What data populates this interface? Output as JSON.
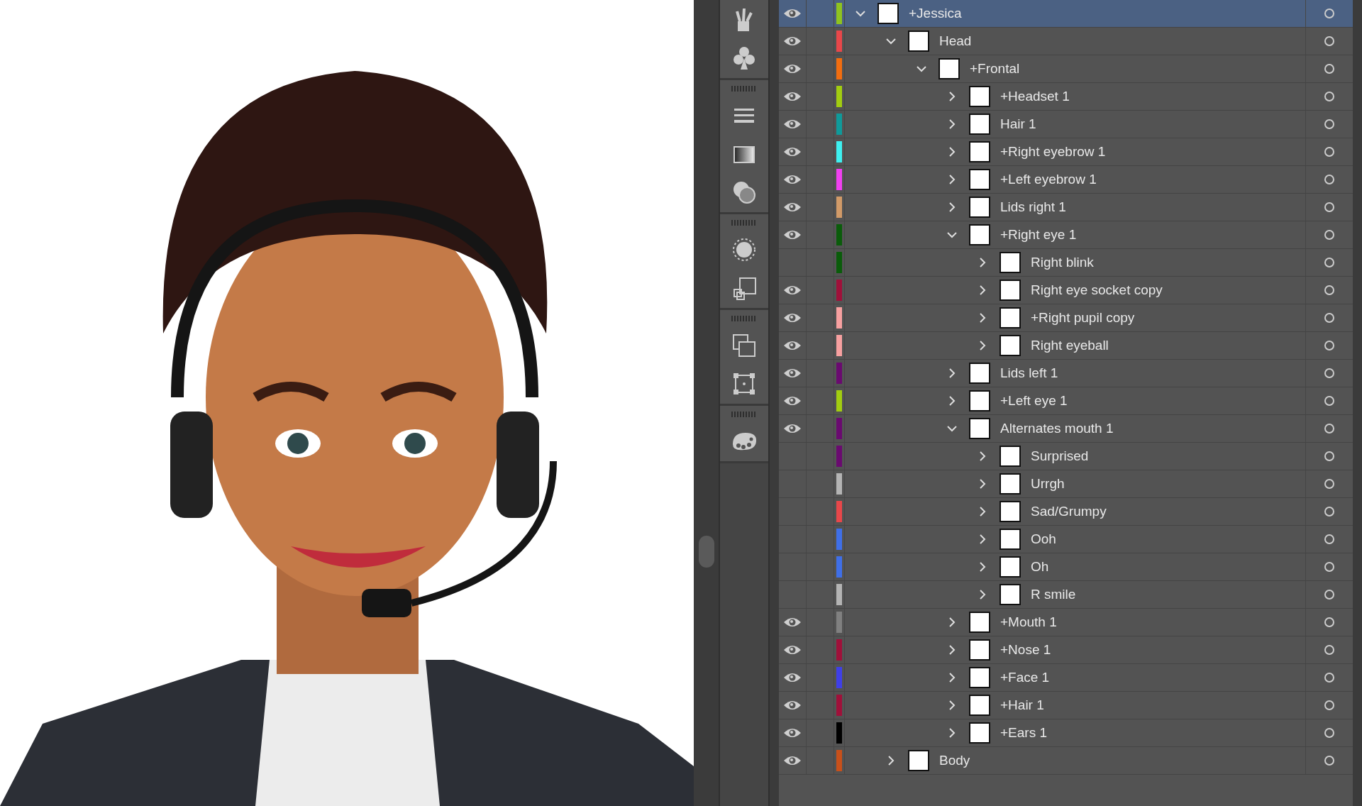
{
  "layers": [
    {
      "name": "+Jessica",
      "visible": true,
      "selected": true,
      "expanded": true,
      "color": "#8fc31f",
      "children": [
        {
          "name": "Head",
          "visible": true,
          "selected": false,
          "expanded": true,
          "color": "#e8474a",
          "children": [
            {
              "name": "+Frontal",
              "visible": true,
              "selected": false,
              "expanded": true,
              "color": "#f26d0f",
              "children": [
                {
                  "name": "+Headset 1",
                  "visible": true,
                  "selected": false,
                  "expanded": false,
                  "color": "#a2cd10"
                },
                {
                  "name": "Hair 1",
                  "visible": true,
                  "selected": false,
                  "expanded": false,
                  "color": "#0f9a9a"
                },
                {
                  "name": "+Right eyebrow 1",
                  "visible": true,
                  "selected": false,
                  "expanded": false,
                  "color": "#3ef0f0"
                },
                {
                  "name": "+Left eyebrow 1",
                  "visible": true,
                  "selected": false,
                  "expanded": false,
                  "color": "#f040f0"
                },
                {
                  "name": "Lids right 1",
                  "visible": true,
                  "selected": false,
                  "expanded": false,
                  "color": "#d19a68"
                },
                {
                  "name": "+Right eye 1",
                  "visible": true,
                  "selected": false,
                  "expanded": true,
                  "color": "#0a5c0a",
                  "children": [
                    {
                      "name": "Right blink",
                      "visible": false,
                      "selected": false,
                      "expanded": false,
                      "color": "#0a5c0a"
                    },
                    {
                      "name": "Right eye socket copy",
                      "visible": true,
                      "selected": false,
                      "expanded": false,
                      "color": "#a0103a"
                    },
                    {
                      "name": "+Right pupil copy",
                      "visible": true,
                      "selected": false,
                      "expanded": false,
                      "color": "#f7a0a0"
                    },
                    {
                      "name": "Right eyeball",
                      "visible": true,
                      "selected": false,
                      "expanded": false,
                      "color": "#f7a0a0"
                    }
                  ]
                },
                {
                  "name": "Lids left 1",
                  "visible": true,
                  "selected": false,
                  "expanded": false,
                  "color": "#6a0a70"
                },
                {
                  "name": "+Left eye 1",
                  "visible": true,
                  "selected": false,
                  "expanded": false,
                  "color": "#a2cd10"
                },
                {
                  "name": "Alternates mouth 1",
                  "visible": true,
                  "selected": false,
                  "expanded": true,
                  "color": "#6a0a70",
                  "children": [
                    {
                      "name": "Surprised",
                      "visible": false,
                      "selected": false,
                      "expanded": false,
                      "color": "#6a0a70"
                    },
                    {
                      "name": "Urrgh",
                      "visible": false,
                      "selected": false,
                      "expanded": false,
                      "color": "#b4b4b4"
                    },
                    {
                      "name": "Sad/Grumpy",
                      "visible": false,
                      "selected": false,
                      "expanded": false,
                      "color": "#e8474a"
                    },
                    {
                      "name": "Ooh",
                      "visible": false,
                      "selected": false,
                      "expanded": false,
                      "color": "#3f6fe8"
                    },
                    {
                      "name": "Oh",
                      "visible": false,
                      "selected": false,
                      "expanded": false,
                      "color": "#3f6fe8"
                    },
                    {
                      "name": "R smile",
                      "visible": false,
                      "selected": false,
                      "expanded": false,
                      "color": "#b4b4b4"
                    }
                  ]
                },
                {
                  "name": "+Mouth 1",
                  "visible": true,
                  "selected": false,
                  "expanded": false,
                  "color": "#808080"
                },
                {
                  "name": "+Nose 1",
                  "visible": true,
                  "selected": false,
                  "expanded": false,
                  "color": "#a0103a"
                },
                {
                  "name": "+Face 1",
                  "visible": true,
                  "selected": false,
                  "expanded": false,
                  "color": "#3f3fe8"
                },
                {
                  "name": "+Hair 1",
                  "visible": true,
                  "selected": false,
                  "expanded": false,
                  "color": "#a0103a"
                },
                {
                  "name": "+Ears 1",
                  "visible": true,
                  "selected": false,
                  "expanded": false,
                  "color": "#000000"
                }
              ]
            }
          ]
        },
        {
          "name": "Body",
          "visible": true,
          "selected": false,
          "expanded": false,
          "color": "#c8501a"
        }
      ]
    }
  ]
}
